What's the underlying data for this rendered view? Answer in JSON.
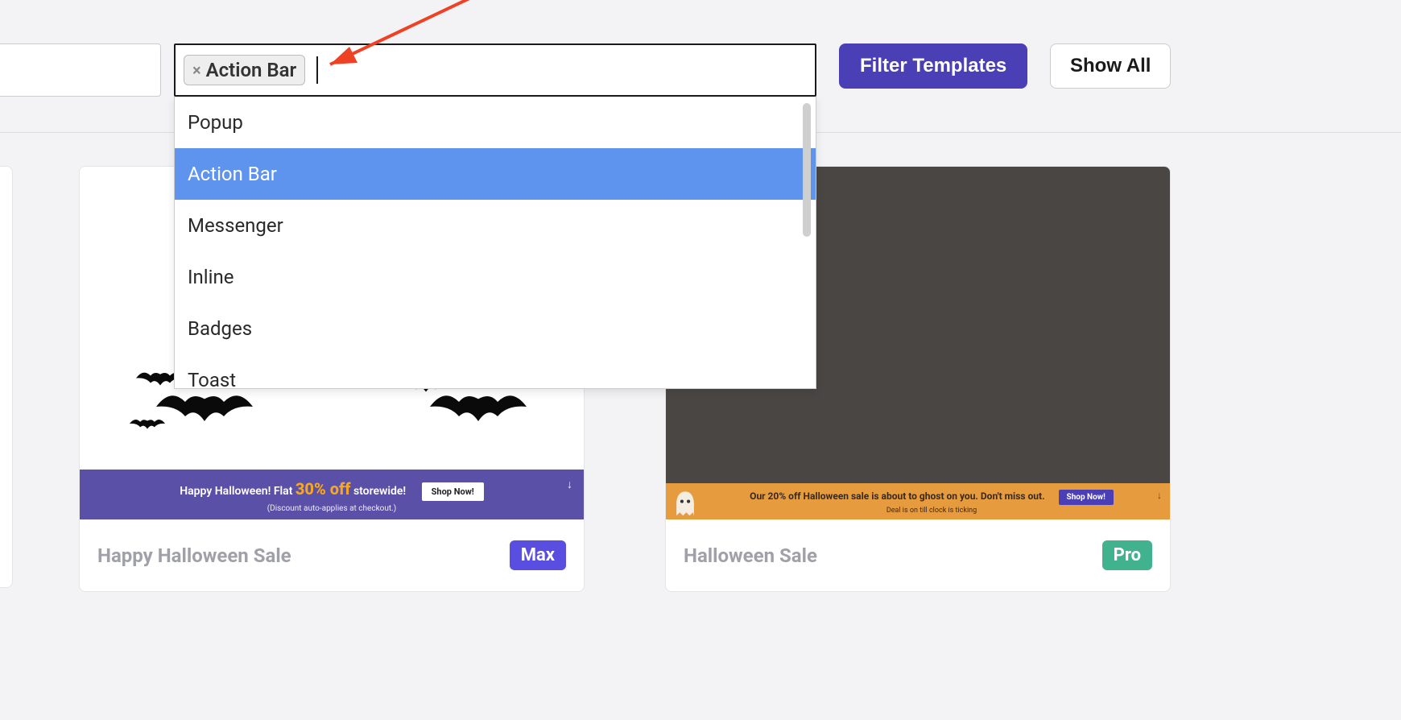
{
  "filterBar": {
    "selectedTag": "Action Bar",
    "dropdownOptions": [
      "Popup",
      "Action Bar",
      "Messenger",
      "Inline",
      "Badges",
      "Toast"
    ],
    "selectedIndex": 1,
    "filterButton": "Filter Templates",
    "showAllButton": "Show All"
  },
  "cards": [
    {
      "title": "Happy Halloween Sale",
      "tier": "Max",
      "bar": {
        "style": "purple",
        "prefix": "Happy Halloween! Flat ",
        "highlight": "30% off",
        "suffix": " storewide!",
        "cta": "Shop Now!",
        "sub": "(Discount auto-applies at checkout.)"
      }
    },
    {
      "title": "Halloween Sale",
      "tier": "Pro",
      "bar": {
        "style": "orange",
        "text": "Our 20% off Halloween sale is about to ghost on you. Don't miss out.",
        "cta": "Shop Now!",
        "sub": "Deal is on till clock is ticking"
      }
    }
  ],
  "colors": {
    "primary": "#4a3fb5",
    "accent": "#f5a623",
    "badgeMax": "#5a4ee0",
    "badgePro": "#40b28e",
    "dropdownHighlight": "#5e93ee",
    "orangeBar": "#e79b3f"
  }
}
